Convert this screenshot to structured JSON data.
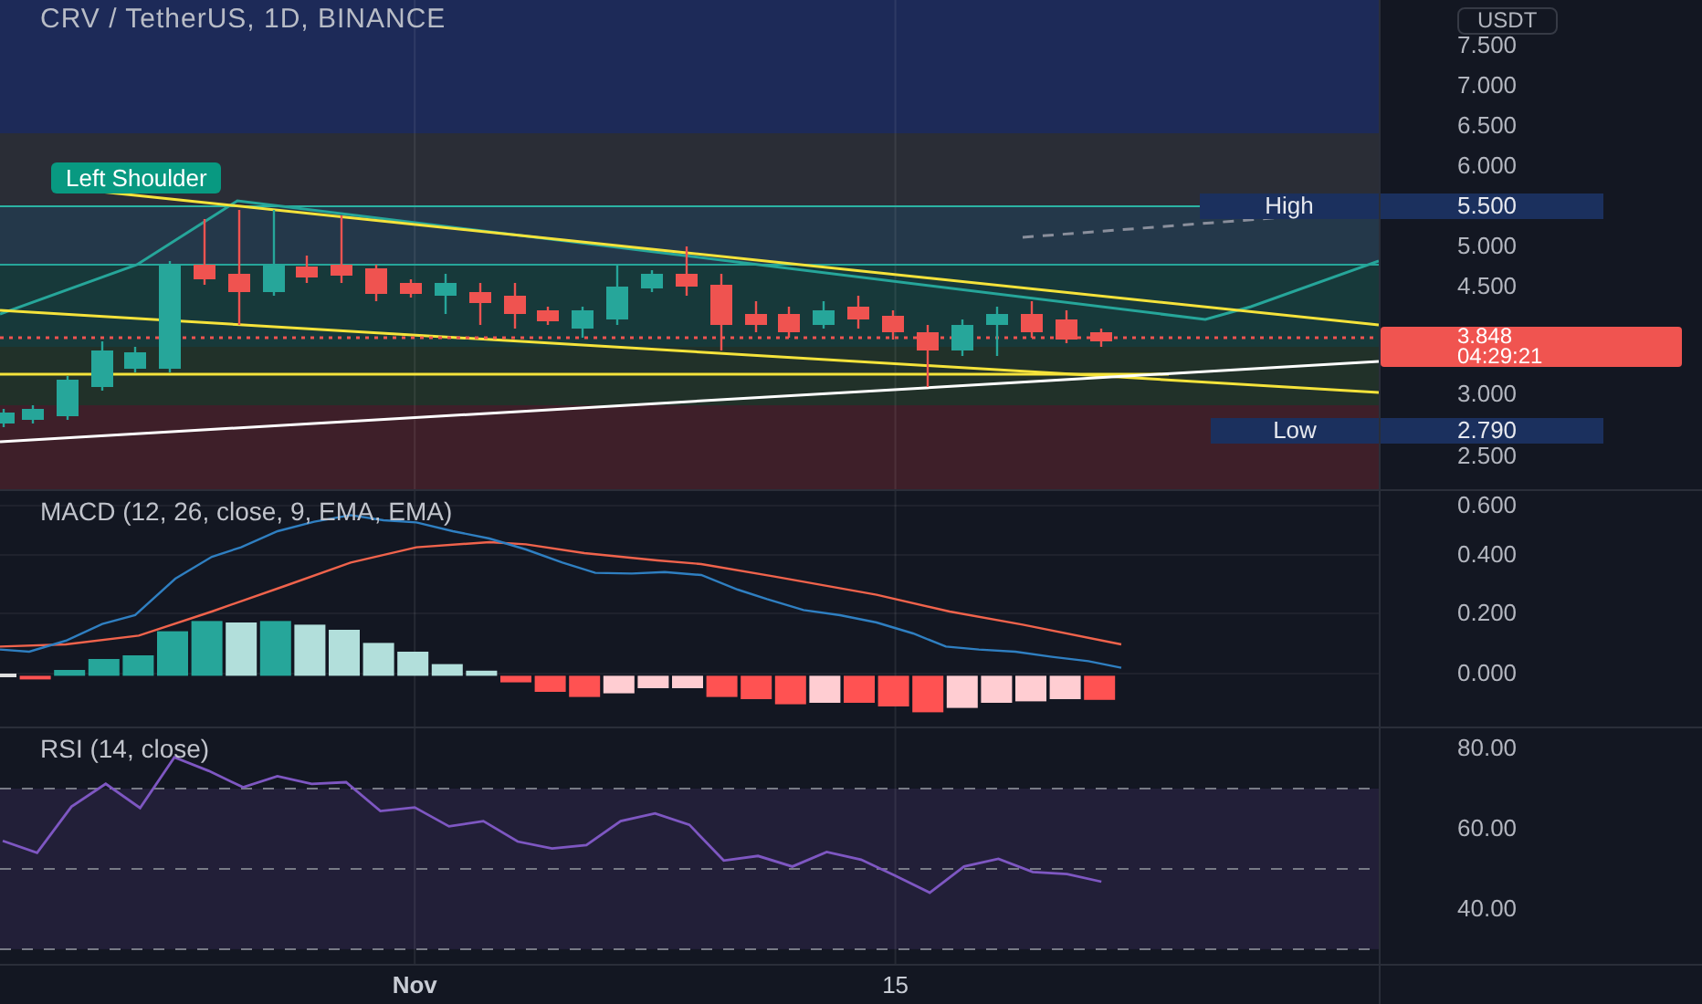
{
  "chart": {
    "title": "CRV / TetherUS, 1D, BINANCE",
    "currency": "USDT",
    "price_axis": [
      "7.500",
      "7.000",
      "6.500",
      "6.000",
      "5.000",
      "4.500",
      "3.000",
      "2.500"
    ],
    "annotations": [
      {
        "kind": "pattern",
        "label": "Left Shoulder"
      }
    ],
    "high": {
      "label": "High",
      "value": "5.500"
    },
    "low": {
      "label": "Low",
      "value": "2.790"
    },
    "last_price": {
      "value": "3.848",
      "countdown": "04:29:21"
    }
  },
  "macd": {
    "title": "MACD (12, 26, close, 9, EMA, EMA)",
    "axis": [
      "0.600",
      "0.400",
      "0.200",
      "0.000"
    ]
  },
  "rsi": {
    "title": "RSI (14, close)",
    "chart_data": {
      "type": "line",
      "categories": [
        null,
        null,
        null,
        null,
        null,
        null,
        null,
        null,
        null,
        null,
        null,
        null,
        "Nov",
        null,
        null,
        null,
        null,
        null,
        null,
        null,
        null,
        null,
        null,
        null,
        null,
        null,
        "15",
        null,
        null,
        null,
        null,
        null,
        null
      ],
      "series": [
        {
          "color": "#7e57c2",
          "values": [
            57,
            54,
            65.5,
            71.2,
            65.2,
            77.8,
            74.4,
            70.3,
            73.1,
            71.2,
            71.6,
            64.4,
            65.3,
            60.6,
            61.9,
            56.8,
            55.1,
            55.9,
            61.9,
            63.8,
            61,
            52.1,
            53.2,
            50.6,
            54.2,
            52.3,
            48.3,
            44.1,
            50.6,
            52.5,
            49.2,
            48.7,
            46.8
          ]
        }
      ],
      "ylim": [
        25.9,
        85
      ],
      "yticks": [
        {
          "value": 40,
          "label": "40.00"
        },
        {
          "value": 60,
          "label": "60.00"
        },
        {
          "value": 80,
          "label": "80.00"
        }
      ]
    }
  }
}
